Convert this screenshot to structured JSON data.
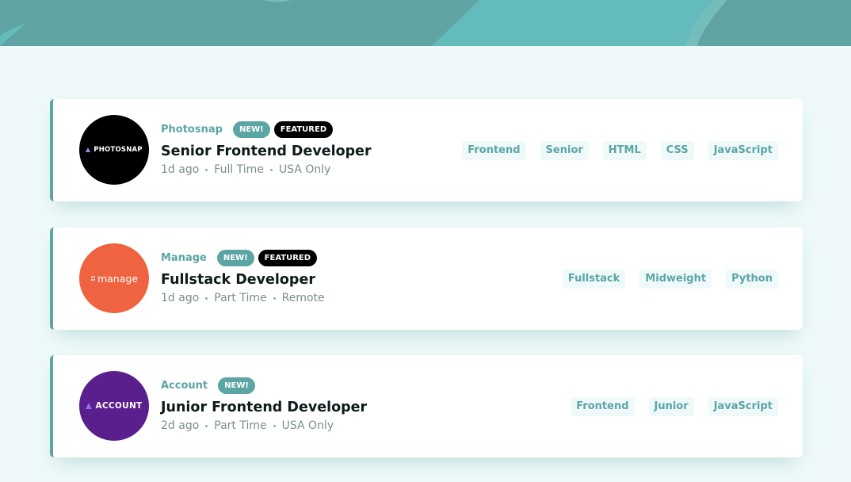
{
  "colors": {
    "header_bg": "#5fa4a3",
    "page_bg": "#eff9f9",
    "accent": "#5ca5a5",
    "featured": "#000000",
    "photosnap_logo": "#000000",
    "manage_logo": "#ef6340",
    "account_logo": "#5a1f8c"
  },
  "jobs": [
    {
      "company": "Photosnap",
      "logo_text": "PHOTOSNAP",
      "logo_icon": "triangle-logo-icon",
      "new_badge": "NEW!",
      "featured_badge": "FEATURED",
      "position": "Senior Frontend Developer",
      "posted": "1d ago",
      "contract": "Full Time",
      "location": "USA Only",
      "tags": [
        "Frontend",
        "Senior",
        "HTML",
        "CSS",
        "JavaScript"
      ]
    },
    {
      "company": "Manage",
      "logo_text": "manage",
      "logo_icon": "dots-logo-icon",
      "new_badge": "NEW!",
      "featured_badge": "FEATURED",
      "position": "Fullstack Developer",
      "posted": "1d ago",
      "contract": "Part Time",
      "location": "Remote",
      "tags": [
        "Fullstack",
        "Midweight",
        "Python"
      ]
    },
    {
      "company": "Account",
      "logo_text": "ACCOUNT",
      "logo_icon": "triangle-logo-icon",
      "new_badge": "NEW!",
      "position": "Junior Frontend Developer",
      "posted": "2d ago",
      "contract": "Part Time",
      "location": "USA Only",
      "tags": [
        "Frontend",
        "Junior",
        "JavaScript"
      ]
    }
  ]
}
